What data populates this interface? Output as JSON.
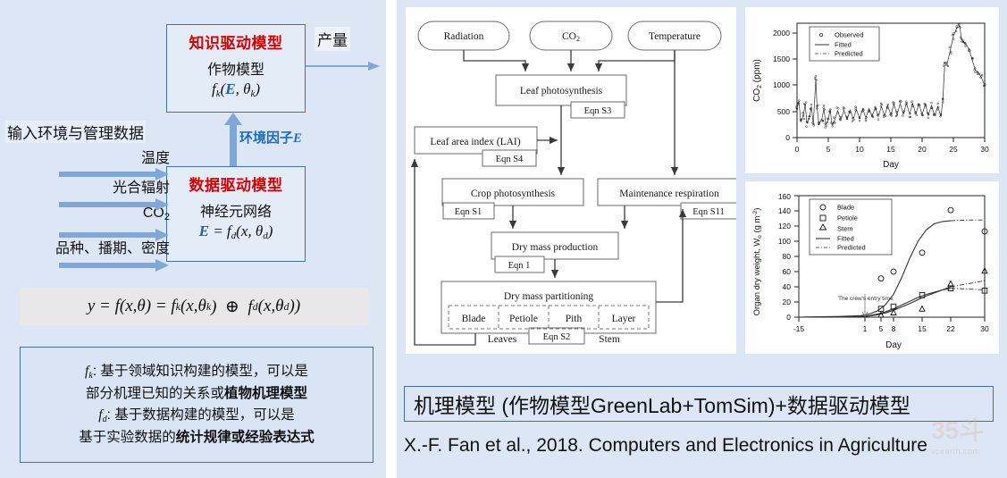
{
  "left_panel": {
    "knowledge_box": {
      "title": "知识驱动模型",
      "subtitle": "作物模型",
      "equation": "f_k(E, θ_k)"
    },
    "data_box": {
      "title": "数据驱动模型",
      "subtitle": "神经元网络",
      "equation": "E = f_d(x, θ_d)"
    },
    "yield_label": "产量",
    "env_factor_label": "环境因子E",
    "input_title": "输入环境与管理数据",
    "inputs": [
      {
        "label": "温度"
      },
      {
        "label": "光合辐射"
      },
      {
        "label": "CO2"
      },
      {
        "label": "品种、播期、密度"
      }
    ],
    "main_equation": "y = f(x,θ) = f_k(x,θ_k) ⊕ f_d(x,θ_d))",
    "legend_lines": [
      {
        "prefix": "f_k",
        "text": ": 基于领域知识构建的模型，可以是"
      },
      {
        "plain": "部分机理已知的关系或",
        "bold": "植物机理模型"
      },
      {
        "prefix": "f_d",
        "text": ": 基于数据构建的模型，可以是"
      },
      {
        "plain": "基于实验数据的",
        "bold": "统计规律或经验表达式"
      }
    ]
  },
  "flowchart": {
    "inputs": [
      "Radiation",
      "CO2",
      "Temperature"
    ],
    "nodes": [
      {
        "id": "leaf-photosynthesis",
        "label": "Leaf photosynthesis",
        "eqn": "Eqn S3"
      },
      {
        "id": "leaf-area-index",
        "label": "Leaf area index (LAI)",
        "eqn": "Eqn S4"
      },
      {
        "id": "crop-photosynthesis",
        "label": "Crop photosynthesis",
        "eqn": "Eqn S1"
      },
      {
        "id": "maintenance-respiration",
        "label": "Maintenance respiration",
        "eqn": "Eqn S11"
      },
      {
        "id": "dry-mass-production",
        "label": "Dry mass production",
        "eqn": "Eqn 1"
      },
      {
        "id": "dry-mass-partitioning",
        "label": "Dry mass partitioning",
        "eqn": "Eqn S2"
      }
    ],
    "partition_cells": [
      "Blade",
      "Petiole",
      "Pith",
      "Layer"
    ],
    "group_labels": [
      "Leaves",
      "Stem"
    ]
  },
  "chart_data": [
    {
      "id": "co2-chart",
      "type": "line",
      "title": "",
      "xlabel": "Day",
      "ylabel": "CO2 (ppm)",
      "xlim": [
        0,
        30
      ],
      "ylim": [
        0,
        2200
      ],
      "xticks": [
        0,
        5,
        10,
        15,
        20,
        25,
        30
      ],
      "yticks": [
        0,
        500,
        1000,
        1500,
        2000
      ],
      "grid": false,
      "legend_position": "top-left",
      "legend": [
        "Observed",
        "Fitted",
        "Predicted"
      ],
      "series": [
        {
          "name": "Fitted",
          "x": [
            0,
            0.3,
            0.6,
            1,
            1.3,
            1.6,
            2,
            2.3,
            2.6,
            3,
            3.2,
            3.5,
            4,
            4.3,
            4.6,
            5,
            5.3,
            5.6,
            6,
            6.5,
            7,
            7.5,
            8,
            8.5,
            9,
            9.5,
            10,
            10.5,
            11,
            11.5,
            12,
            12.5,
            13,
            13.5,
            14,
            14.5,
            15,
            15.5,
            16,
            16.5,
            17,
            17.5,
            18,
            18.5,
            19,
            19.5,
            20,
            20.5,
            21,
            21.5,
            22,
            22.5,
            23,
            23.3,
            23.6,
            24,
            24.5,
            25,
            25.5,
            26,
            26.3,
            26.7,
            27,
            27.5,
            28,
            28.5,
            29,
            29.5,
            30
          ],
          "values": [
            560,
            700,
            300,
            420,
            640,
            270,
            390,
            600,
            250,
            1130,
            600,
            250,
            370,
            560,
            250,
            350,
            540,
            240,
            330,
            520,
            340,
            520,
            350,
            530,
            360,
            540,
            370,
            550,
            380,
            560,
            400,
            580,
            410,
            600,
            420,
            620,
            430,
            640,
            440,
            650,
            450,
            660,
            450,
            660,
            450,
            650,
            440,
            640,
            430,
            620,
            420,
            600,
            410,
            700,
            1380,
            1420,
            1680,
            1950,
            2100,
            2150,
            1900,
            1820,
            1800,
            1700,
            1500,
            1300,
            1250,
            1150,
            1000
          ]
        }
      ],
      "notes": "Observed points scatter tightly around the fitted diurnal oscillation; Predicted (dash-dot) overlays from day ~23.5 to 30."
    },
    {
      "id": "organ-dry-weight-chart",
      "type": "scatter",
      "title": "",
      "xlabel": "Day",
      "ylabel": "Organ dry weight, W_o (g m^-2)",
      "xlim": [
        -15,
        30
      ],
      "ylim": [
        0,
        160
      ],
      "xticks": [
        -15,
        1,
        5,
        8,
        15,
        22,
        30
      ],
      "yticks": [
        0,
        20,
        40,
        60,
        80,
        100,
        120,
        140,
        160
      ],
      "grid": false,
      "legend_position": "top-left",
      "legend": [
        "Blade",
        "Petiole",
        "Stem",
        "Fitted",
        "Predicted"
      ],
      "annotation": "The crew's entry time",
      "annotation_x": 1,
      "series": [
        {
          "name": "Blade",
          "marker": "circle",
          "x": [
            5,
            8,
            15,
            22,
            30
          ],
          "values": [
            51,
            60,
            85,
            141,
            113
          ]
        },
        {
          "name": "Petiole",
          "marker": "square",
          "x": [
            5,
            8,
            15,
            22,
            30
          ],
          "values": [
            11,
            14,
            29,
            38,
            35
          ]
        },
        {
          "name": "Stem",
          "marker": "triangle",
          "x": [
            5,
            8,
            15,
            22,
            30
          ],
          "values": [
            3,
            6,
            11,
            44,
            61
          ]
        },
        {
          "name": "Fitted Blade",
          "line": "solid",
          "x": [
            -15,
            -10,
            -5,
            0,
            2,
            4,
            6,
            8,
            10,
            12,
            14,
            16,
            18,
            20,
            22
          ],
          "values": [
            0,
            0.5,
            1,
            2,
            4,
            8,
            16,
            30,
            52,
            78,
            100,
            115,
            123,
            126,
            127
          ]
        },
        {
          "name": "Fitted Petiole",
          "line": "solid",
          "x": [
            -15,
            -10,
            -5,
            0,
            2,
            4,
            6,
            8,
            10,
            12,
            14,
            16,
            18,
            20,
            22
          ],
          "values": [
            0,
            0.2,
            0.4,
            1,
            2,
            4,
            7,
            11,
            16,
            21,
            26,
            30,
            33,
            36,
            38
          ]
        },
        {
          "name": "Fitted Stem",
          "line": "solid",
          "x": [
            -15,
            -10,
            -5,
            0,
            2,
            4,
            6,
            8,
            10,
            12,
            14,
            16,
            18,
            20,
            22
          ],
          "values": [
            0,
            0.1,
            0.3,
            0.7,
            1.5,
            3,
            5.5,
            9,
            13.5,
            18,
            23,
            28,
            32,
            36,
            40
          ]
        },
        {
          "name": "Predicted Blade",
          "line": "dashdot",
          "x": [
            22,
            26,
            30
          ],
          "values": [
            127,
            128,
            128
          ]
        },
        {
          "name": "Predicted Petiole",
          "line": "dashdot",
          "x": [
            22,
            26,
            30
          ],
          "values": [
            38,
            37,
            36
          ]
        },
        {
          "name": "Predicted Stem",
          "line": "dashdot",
          "x": [
            22,
            26,
            30
          ],
          "values": [
            40,
            44,
            48
          ]
        }
      ]
    }
  ],
  "captions": {
    "main": "机理模型 (作物模型GreenLab+TomSim)+数据驱动模型",
    "citation": "X.-F. Fan et al., 2018. Computers and Electronics in Agriculture"
  },
  "watermark": {
    "big": "35斗",
    "small": "vcearth.com"
  },
  "colors": {
    "panel_bg": "#dce6f5",
    "box_border": "#4472a8",
    "title_red": "#d40000",
    "accent_blue": "#1b6bc9",
    "arrow_blue": "#7fa8d8"
  }
}
